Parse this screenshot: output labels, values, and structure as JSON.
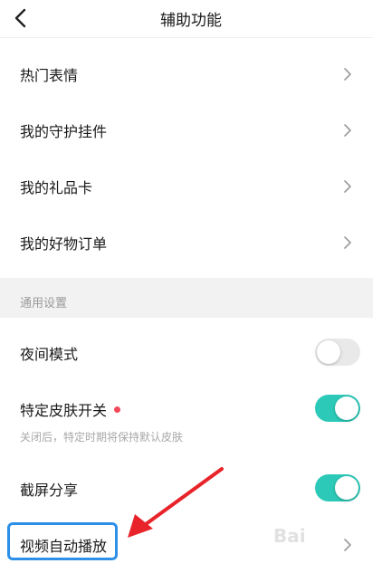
{
  "header": {
    "title": "辅助功能"
  },
  "menu_items": [
    {
      "label": "热门表情"
    },
    {
      "label": "我的守护挂件"
    },
    {
      "label": "我的礼品卡"
    },
    {
      "label": "我的好物订单"
    }
  ],
  "section": {
    "title": "通用设置"
  },
  "settings": {
    "night_mode": {
      "label": "夜间模式",
      "enabled": false
    },
    "skin_switch": {
      "label": "特定皮肤开关",
      "enabled": true,
      "note": "关闭后，特定时期将保持默认皮肤"
    },
    "screenshot_share": {
      "label": "截屏分享",
      "enabled": true
    },
    "video_autoplay": {
      "label": "视频自动播放"
    }
  },
  "watermark": {
    "text": "Bai"
  },
  "colors": {
    "toggle_on": "#2cc9b8",
    "toggle_off": "#e9e9e9",
    "highlight": "#2d8fe8",
    "arrow": "#e8232a",
    "red_dot": "#f24a5b"
  }
}
